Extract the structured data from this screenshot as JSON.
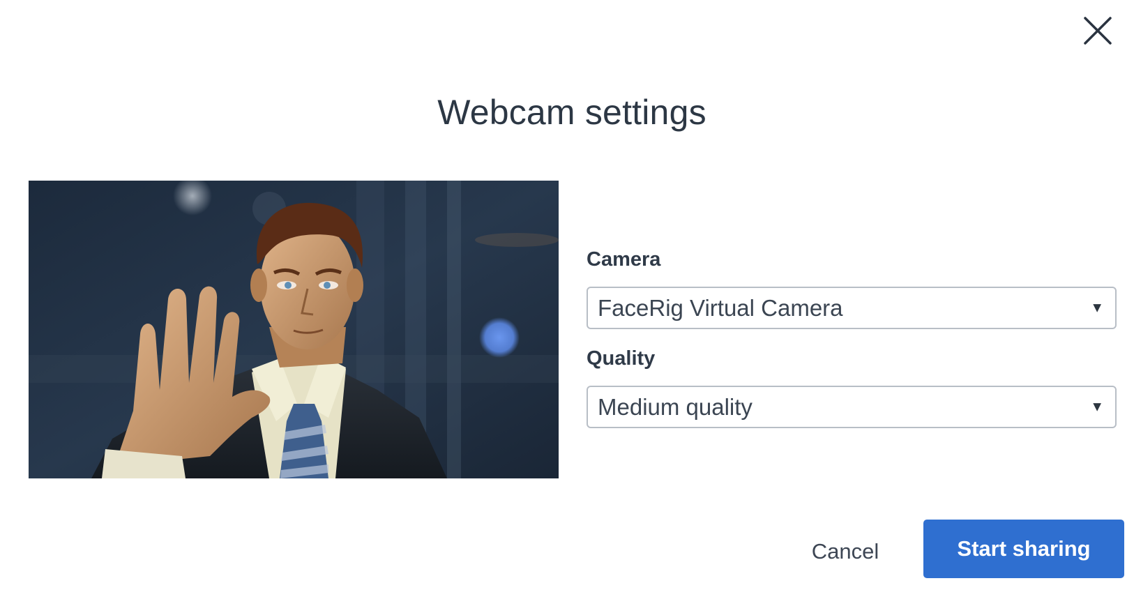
{
  "dialog": {
    "title": "Webcam settings",
    "close_icon": "close-icon"
  },
  "preview": {
    "icon": "webcam-preview-image"
  },
  "camera": {
    "label": "Camera",
    "selected": "FaceRig Virtual Camera"
  },
  "quality": {
    "label": "Quality",
    "selected": "Medium quality"
  },
  "actions": {
    "cancel_label": "Cancel",
    "start_label": "Start sharing"
  },
  "colors": {
    "primary": "#2f6fd0",
    "border": "#b8bec6",
    "text": "#2c3744"
  }
}
